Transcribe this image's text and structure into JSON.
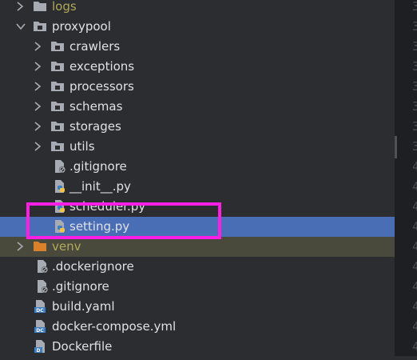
{
  "project_tree": {
    "items": [
      {
        "label": "logs",
        "type": "folder",
        "expanded": false
      },
      {
        "label": "proxypool",
        "type": "folder",
        "expanded": true
      },
      {
        "label": "crawlers",
        "type": "folder",
        "expanded": false
      },
      {
        "label": "exceptions",
        "type": "folder",
        "expanded": false
      },
      {
        "label": "processors",
        "type": "folder",
        "expanded": false
      },
      {
        "label": "schemas",
        "type": "folder",
        "expanded": false
      },
      {
        "label": "storages",
        "type": "folder",
        "expanded": false
      },
      {
        "label": "utils",
        "type": "folder",
        "expanded": false
      },
      {
        "label": ".gitignore",
        "type": "ignore-file"
      },
      {
        "label": "__init__.py",
        "type": "python-file"
      },
      {
        "label": "scheduler.py",
        "type": "python-file"
      },
      {
        "label": "setting.py",
        "type": "python-file",
        "selected": true
      },
      {
        "label": "venv",
        "type": "folder",
        "expanded": false
      },
      {
        "label": ".dockerignore",
        "type": "ignore-file"
      },
      {
        "label": ".gitignore",
        "type": "ignore-file"
      },
      {
        "label": "build.yaml",
        "type": "docker-file"
      },
      {
        "label": "docker-compose.yml",
        "type": "docker-file"
      },
      {
        "label": "Dockerfile",
        "type": "dockerfile"
      }
    ]
  },
  "gutter": {
    "line_digits": [
      "3",
      "3",
      "3",
      "3",
      "3",
      "3",
      "3",
      "3",
      "4",
      "4",
      "4",
      "4",
      "4",
      "4",
      "4",
      "4",
      "4",
      "4"
    ]
  },
  "highlight": {
    "color": "#ff1fe4"
  },
  "colors": {
    "background": "#2b2d30",
    "selection": "#4a6eb5",
    "folder_icon": "#a7abb3",
    "venv_folder_icon": "#d9822b",
    "python_blue": "#3e7fc4",
    "python_yellow": "#f5c342"
  }
}
